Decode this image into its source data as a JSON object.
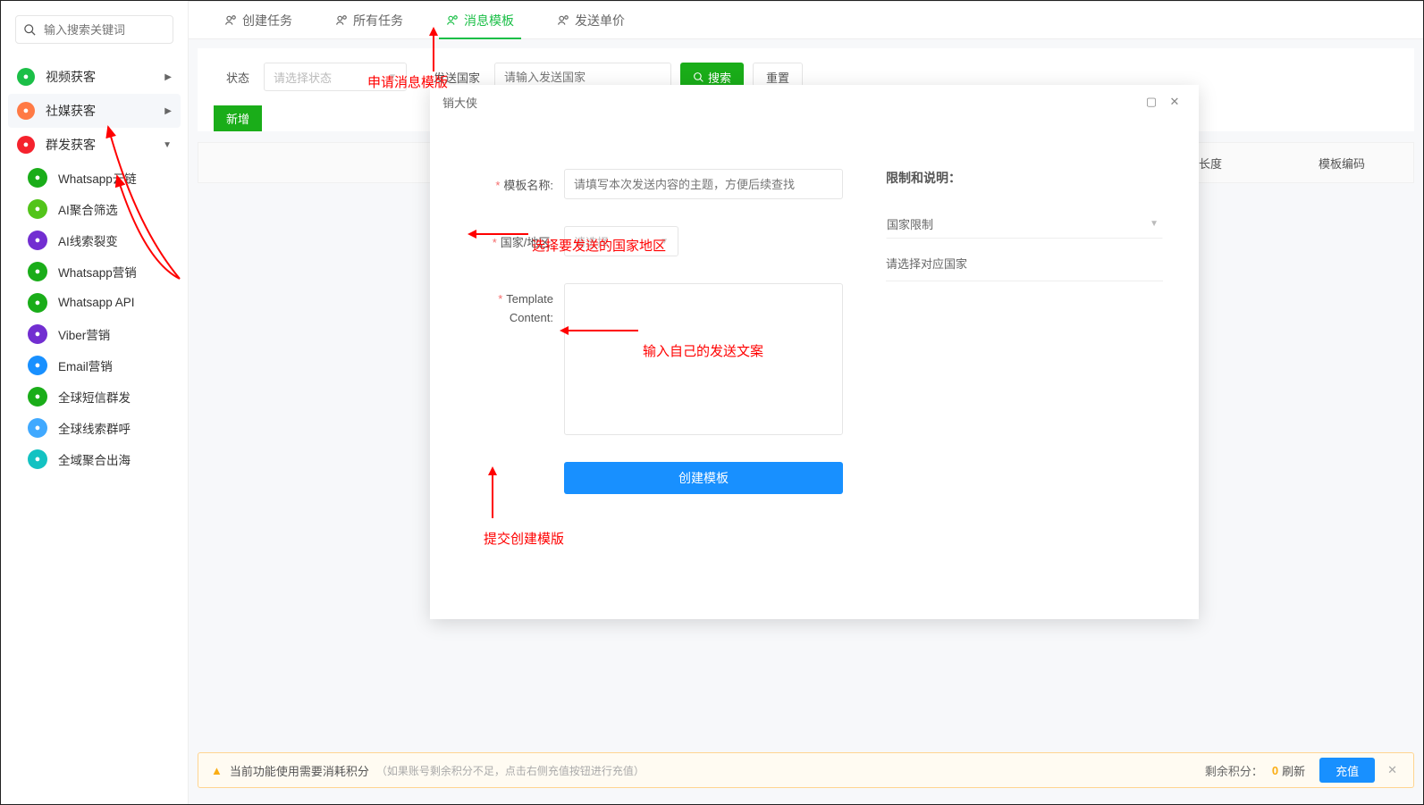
{
  "search_placeholder": "输入搜索关键词",
  "cats": [
    {
      "label": "视频获客",
      "arrow": "▶",
      "color": "#1bbf47",
      "name": "sidebar-cat-video"
    },
    {
      "label": "社媒获客",
      "arrow": "▶",
      "color": "#ff7a45",
      "name": "sidebar-cat-social",
      "active": true
    },
    {
      "label": "群发获客",
      "arrow": "▼",
      "color": "#f5222d",
      "name": "sidebar-cat-mass"
    }
  ],
  "subs": [
    {
      "label": "Whatsapp云链",
      "color": "#1aad19",
      "name": "sidebar-item-whatsapp-cloud"
    },
    {
      "label": "AI聚合筛选",
      "color": "#52c41a",
      "name": "sidebar-item-ai-filter"
    },
    {
      "label": "AI线索裂变",
      "color": "#722ed1",
      "name": "sidebar-item-ai-split"
    },
    {
      "label": "Whatsapp营销",
      "color": "#1aad19",
      "name": "sidebar-item-whatsapp-mkt"
    },
    {
      "label": "Whatsapp API",
      "color": "#1aad19",
      "name": "sidebar-item-whatsapp-api"
    },
    {
      "label": "Viber营销",
      "color": "#722ed1",
      "name": "sidebar-item-viber"
    },
    {
      "label": "Email营销",
      "color": "#1890ff",
      "name": "sidebar-item-email"
    },
    {
      "label": "全球短信群发",
      "color": "#1aad19",
      "name": "sidebar-item-sms"
    },
    {
      "label": "全球线索群呼",
      "color": "#40a9ff",
      "name": "sidebar-item-call"
    },
    {
      "label": "全域聚合出海",
      "color": "#13c2c2",
      "name": "sidebar-item-global"
    }
  ],
  "tabs": [
    {
      "label": "创建任务",
      "name": "tab-create"
    },
    {
      "label": "所有任务",
      "name": "tab-all"
    },
    {
      "label": "消息模板",
      "name": "tab-template",
      "active": true
    },
    {
      "label": "发送单价",
      "name": "tab-price"
    }
  ],
  "filters": {
    "status_label": "状态",
    "status_placeholder": "请选择状态",
    "country_label": "发送国家",
    "country_placeholder": "请输入发送国家",
    "search_btn": "搜索",
    "reset_btn": "重置"
  },
  "new_btn": "新增",
  "modal": {
    "title": "销大侠",
    "name_label": "模板名称:",
    "name_placeholder": "请填写本次发送内容的主题，方便后续查找",
    "region_label": "国家/地区:",
    "region_placeholder": "请选择",
    "content_label_1": "Template",
    "content_label_2": "Content:",
    "submit": "创建模板",
    "limit_title": "限制和说明：",
    "limit_sel": "国家限制",
    "limit_txt": "请选择对应国家"
  },
  "table": {
    "th1": "模板长度",
    "th2": "模板编码"
  },
  "annotations": {
    "a1": "申请消息模版",
    "a2": "选择要发送的国家地区",
    "a3": "输入自己的发送文案",
    "a4": "提交创建模版"
  },
  "footer": {
    "msg": "当前功能使用需要消耗积分",
    "tip": "（如果账号剩余积分不足，点击右侧充值按钮进行充值）",
    "points_label": "剩余积分：",
    "points_value": "0",
    "refresh": "刷新",
    "recharge": "充值"
  }
}
